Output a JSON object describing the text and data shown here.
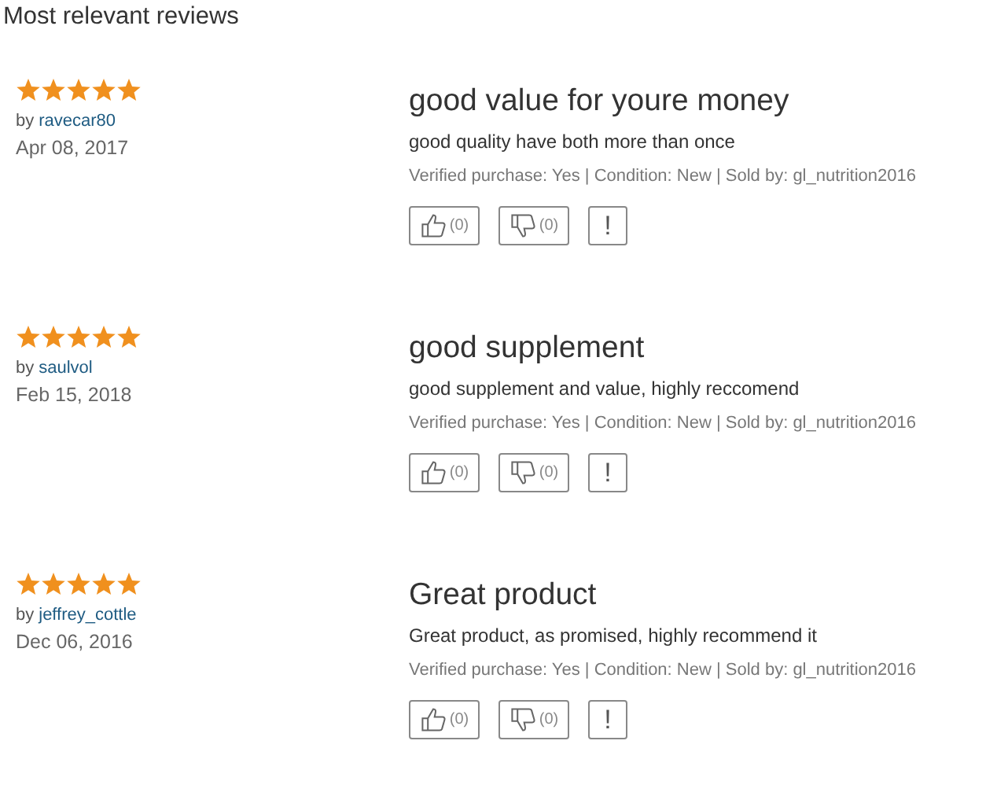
{
  "heading": "Most relevant reviews",
  "reviews": [
    {
      "stars": 5,
      "by": "by",
      "author": "ravecar80",
      "date": "Apr 08, 2017",
      "title": "good value for youre money",
      "body": "good quality have both more than once",
      "meta": "Verified purchase: Yes | Condition: New | Sold by: gl_nutrition2016",
      "likes": "(0)",
      "dislikes": "(0)",
      "report": "!"
    },
    {
      "stars": 5,
      "by": "by",
      "author": "saulvol",
      "date": "Feb 15, 2018",
      "title": "good supplement",
      "body": "good supplement and value, highly reccomend",
      "meta": "Verified purchase: Yes | Condition: New | Sold by: gl_nutrition2016",
      "likes": "(0)",
      "dislikes": "(0)",
      "report": "!"
    },
    {
      "stars": 5,
      "by": "by",
      "author": "jeffrey_cottle",
      "date": "Dec 06, 2016",
      "title": "Great product",
      "body": "Great product, as promised, highly recommend it",
      "meta": "Verified purchase: Yes | Condition: New | Sold by: gl_nutrition2016",
      "likes": "(0)",
      "dislikes": "(0)",
      "report": "!"
    }
  ]
}
